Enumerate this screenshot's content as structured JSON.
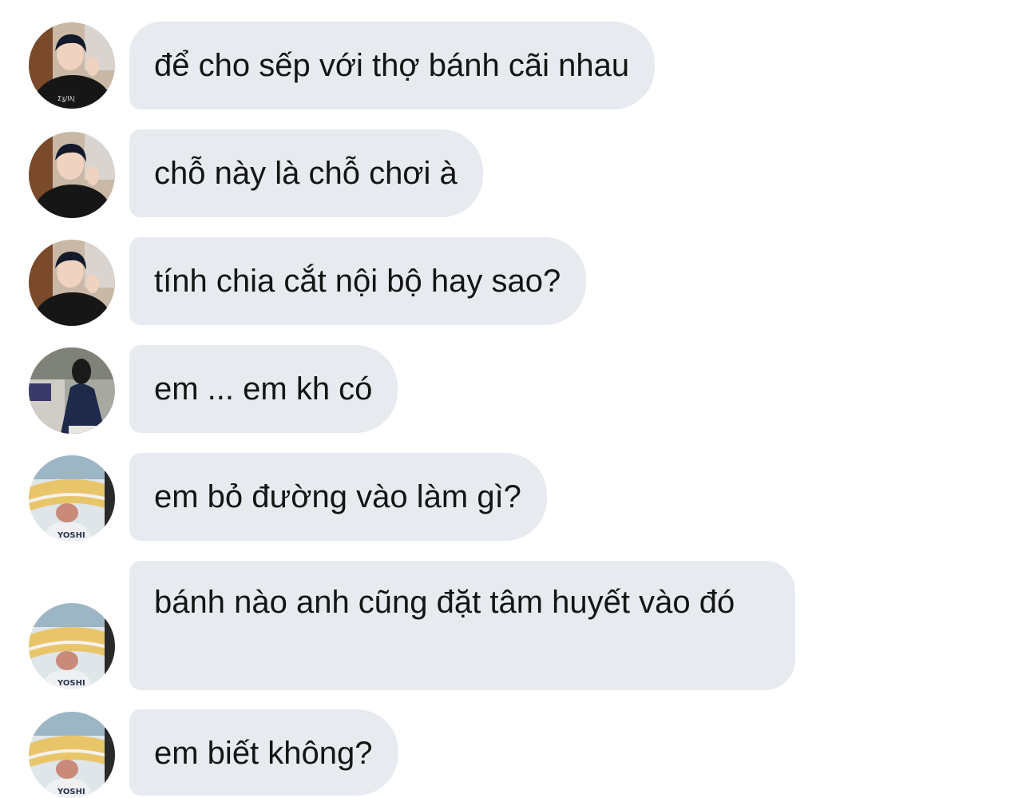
{
  "messages": [
    {
      "text": "để cho sếp với thợ bánh cãi nhau",
      "avatar": "boy-black-shirt-avatar"
    },
    {
      "text": "chỗ này là chỗ chơi à",
      "avatar": "boy-black-shirt-avatar"
    },
    {
      "text": "tính chia cắt nội bộ hay sao?",
      "avatar": "boy-black-shirt-avatar"
    },
    {
      "text": "em ... em kh có",
      "avatar": "girl-navy-dress-avatar"
    },
    {
      "text": "em bỏ đường vào làm gì?",
      "avatar": "stadium-yoshi-avatar"
    },
    {
      "text": "bánh nào anh cũng đặt tâm huyết vào đó",
      "avatar": "stadium-yoshi-avatar"
    },
    {
      "text": "em biết không?",
      "avatar": "stadium-yoshi-avatar"
    }
  ],
  "avatar_shirt_text": "YOSHI",
  "colors": {
    "bubble": "#e7ebf0",
    "text": "#141414",
    "background": "#ffffff"
  }
}
